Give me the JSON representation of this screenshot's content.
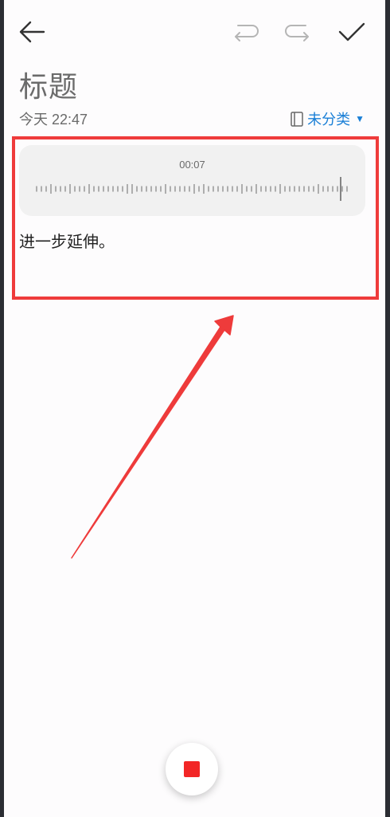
{
  "header": {
    "back_icon": "arrow-left-icon",
    "undo_icon": "undo-icon",
    "redo_icon": "redo-icon",
    "done_icon": "checkmark-icon"
  },
  "note": {
    "title": "标题",
    "date": "今天 22:47",
    "category": "未分类",
    "category_icon": "notebook-icon",
    "body": "进一步延伸。"
  },
  "recording": {
    "elapsed": "00:07",
    "stop_icon": "stop-icon"
  },
  "colors": {
    "accent": "#1a7fd6",
    "highlight": "#ef3b3b",
    "stop": "#f22626"
  }
}
